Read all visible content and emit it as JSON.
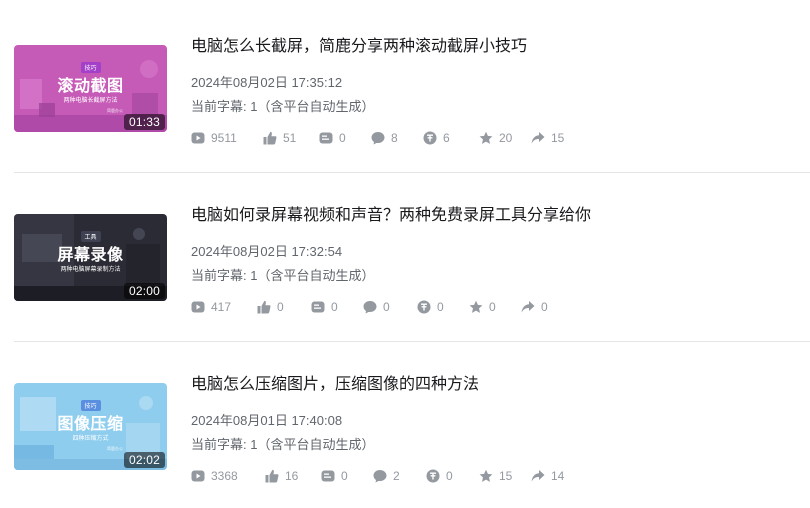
{
  "colors": {
    "title": "#18191c",
    "meta": "#61666d",
    "stat": "#9499a0",
    "divider": "#e3e5e7"
  },
  "videos": [
    {
      "title": "电脑怎么长截屏，简鹿分享两种滚动截屏小技巧",
      "date": "2024年08月02日 17:35:12",
      "subtitle": "当前字幕: 1（含平台自动生成）",
      "duration": "01:33",
      "thumb": {
        "tag": "技巧",
        "heading": "滚动截图",
        "caption": "两种电脑长截屏方法",
        "note": "简鹿办公",
        "bg": "#c75bb8",
        "tag_bg": "#a33fc9"
      },
      "stats": {
        "plays": "9511",
        "likes": "51",
        "danmaku": "0",
        "comments": "8",
        "coins": "6",
        "favorites": "20",
        "shares": "15"
      }
    },
    {
      "title": "电脑如何录屏幕视频和声音？两种免费录屏工具分享给你",
      "date": "2024年08月02日 17:32:54",
      "subtitle": "当前字幕: 1（含平台自动生成）",
      "duration": "02:00",
      "thumb": {
        "tag": "工具",
        "heading": "屏幕录像",
        "caption": "两种电脑屏幕录制方法",
        "note": "",
        "bg": "#2b2b36",
        "tag_bg": "#3f4152"
      },
      "stats": {
        "plays": "417",
        "likes": "0",
        "danmaku": "0",
        "comments": "0",
        "coins": "0",
        "favorites": "0",
        "shares": "0"
      }
    },
    {
      "title": "电脑怎么压缩图片，压缩图像的四种方法",
      "date": "2024年08月01日 17:40:08",
      "subtitle": "当前字幕: 1（含平台自动生成）",
      "duration": "02:02",
      "thumb": {
        "tag": "技巧",
        "heading": "图像压缩",
        "caption": "四种压缩方式",
        "note": "简鹿办公",
        "bg": "#8ecdee",
        "tag_bg": "#5a8fe0"
      },
      "stats": {
        "plays": "3368",
        "likes": "16",
        "danmaku": "0",
        "comments": "2",
        "coins": "0",
        "favorites": "15",
        "shares": "14"
      }
    }
  ]
}
